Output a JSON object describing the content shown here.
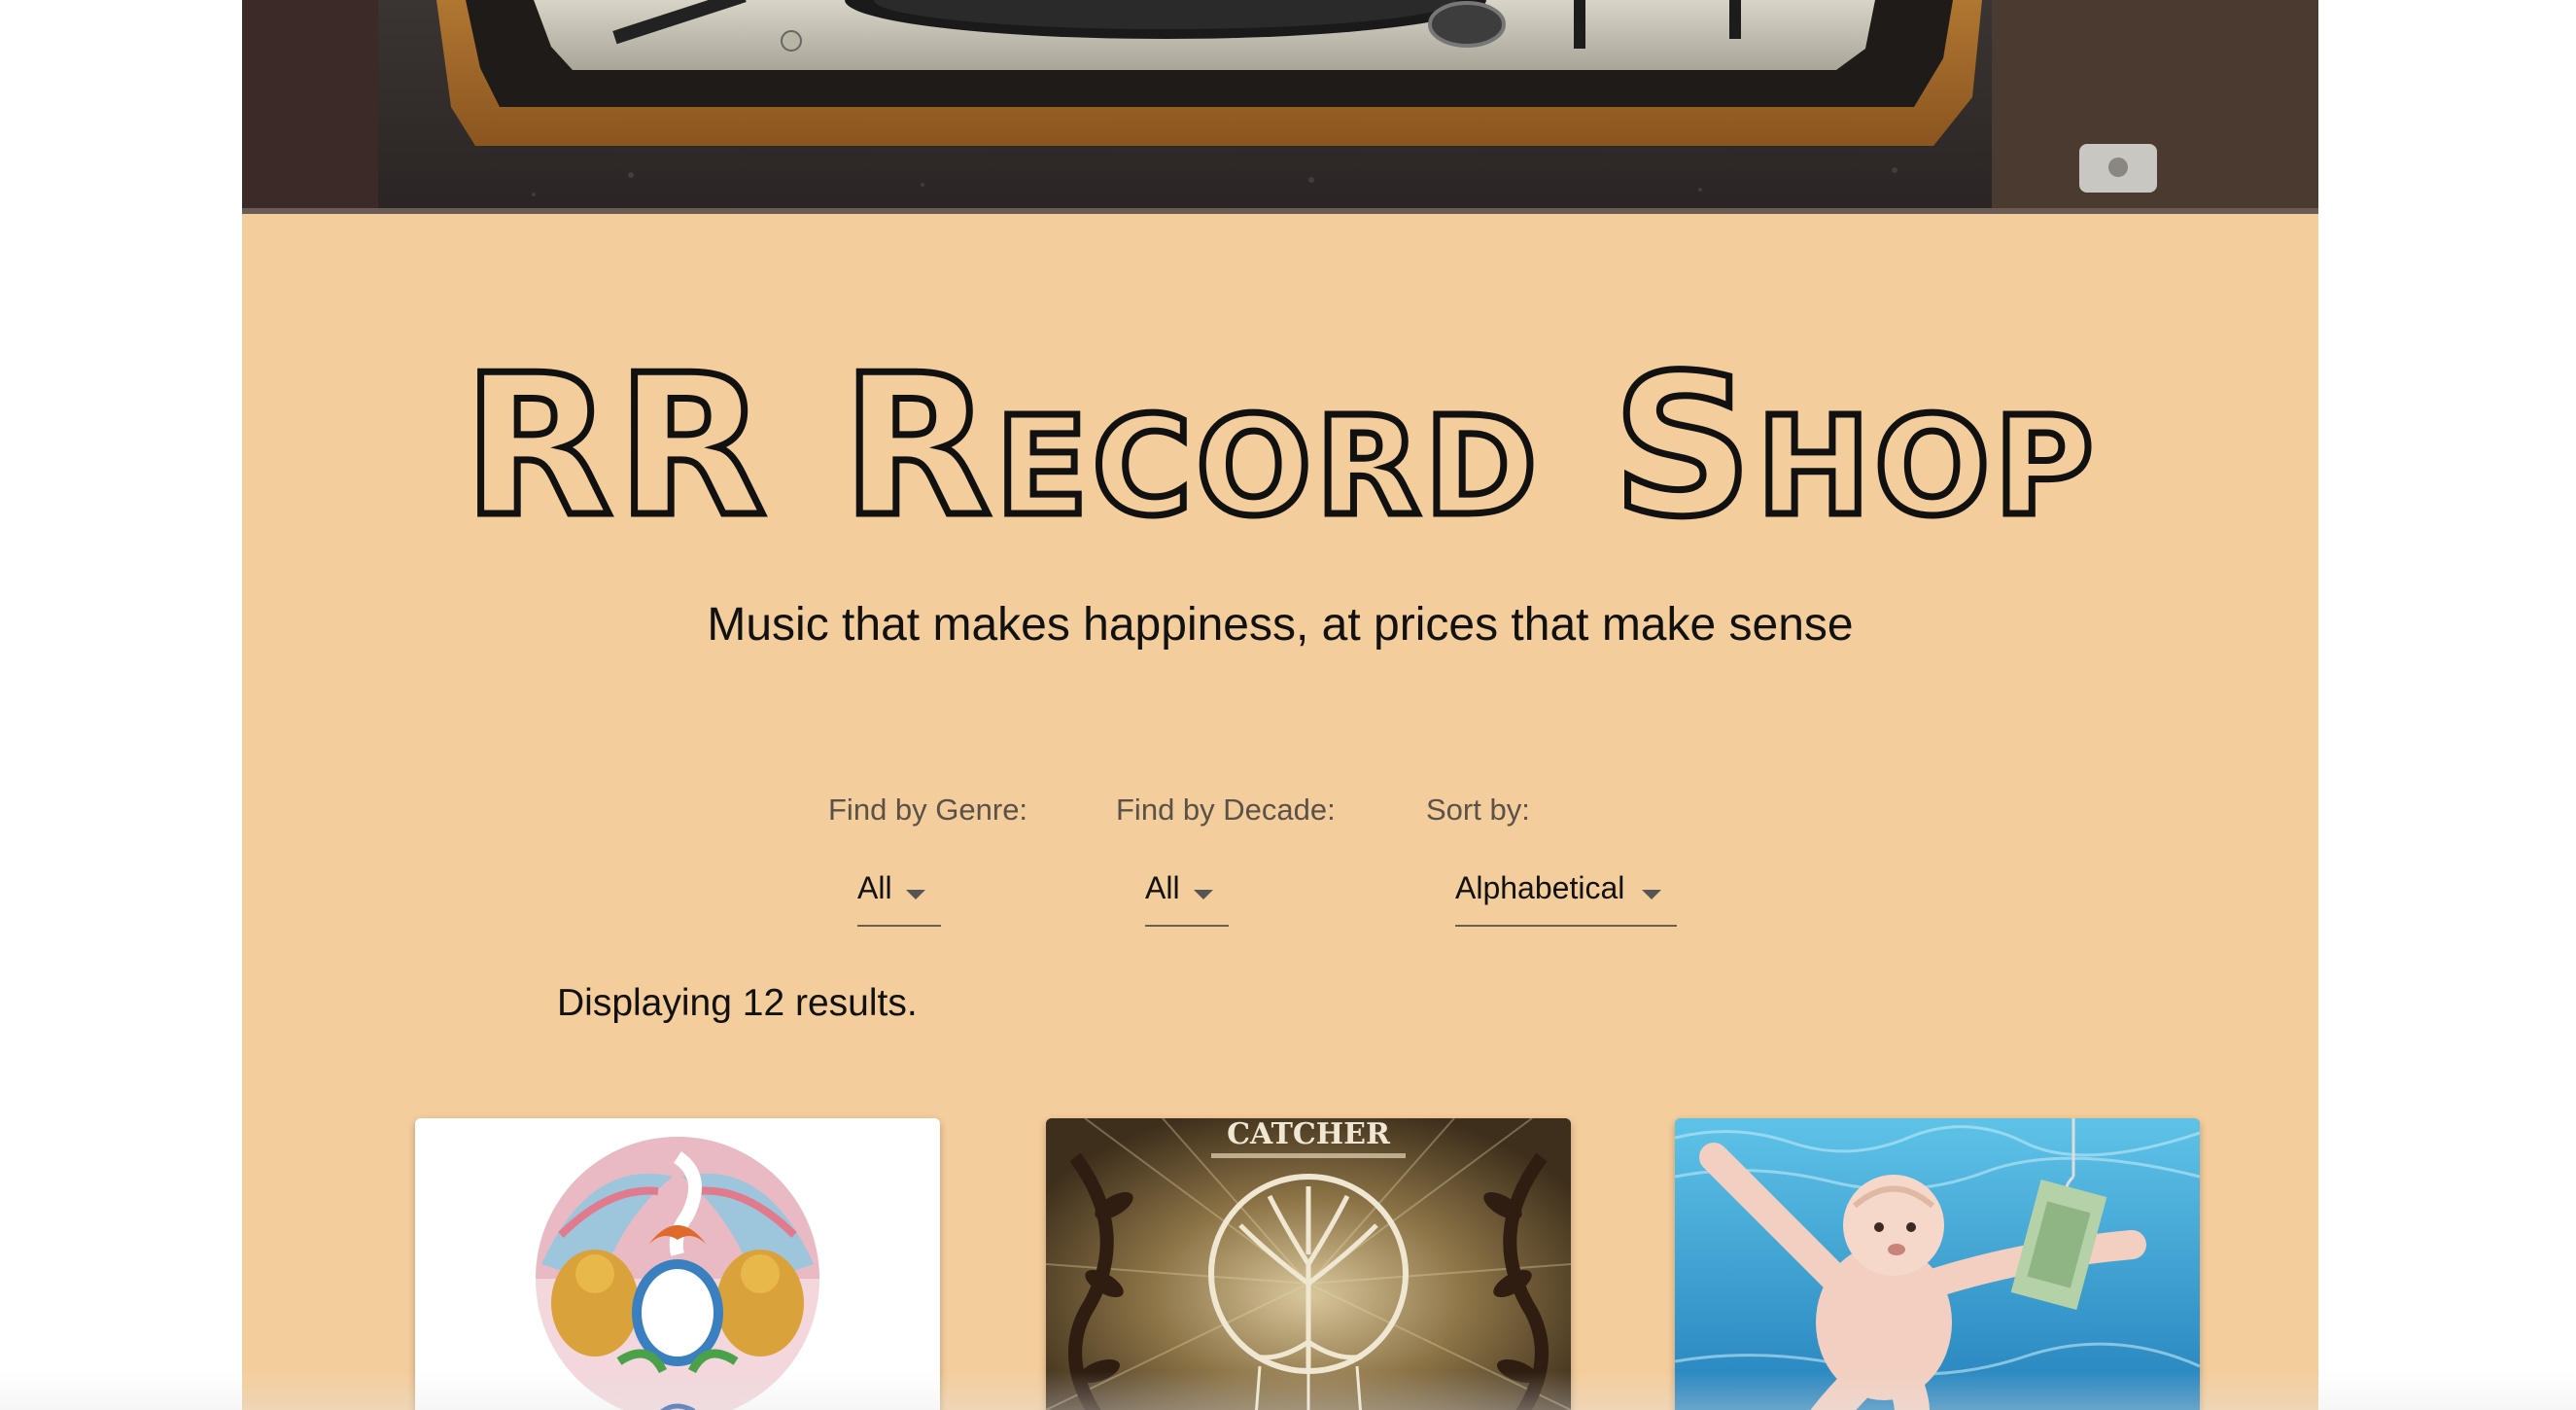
{
  "site": {
    "title": "RR Record Shop",
    "tagline": "Music that makes happiness, at prices that make sense"
  },
  "filters": {
    "genre": {
      "label": "Find by Genre:",
      "value": "All"
    },
    "decade": {
      "label": "Find by Decade:",
      "value": "All"
    },
    "sort": {
      "label": "Sort by:",
      "value": "Alphabetical"
    }
  },
  "results": {
    "text": "Displaying 12 results."
  },
  "albums": [
    {
      "cover": "queen-crest-cover"
    },
    {
      "cover": "tree-of-life-cover",
      "cover_text": "CATCHER"
    },
    {
      "cover": "swimming-baby-cover"
    }
  ],
  "colors": {
    "page_bg": "#f4cd9c",
    "text": "#111111",
    "label": "#5a5148"
  }
}
